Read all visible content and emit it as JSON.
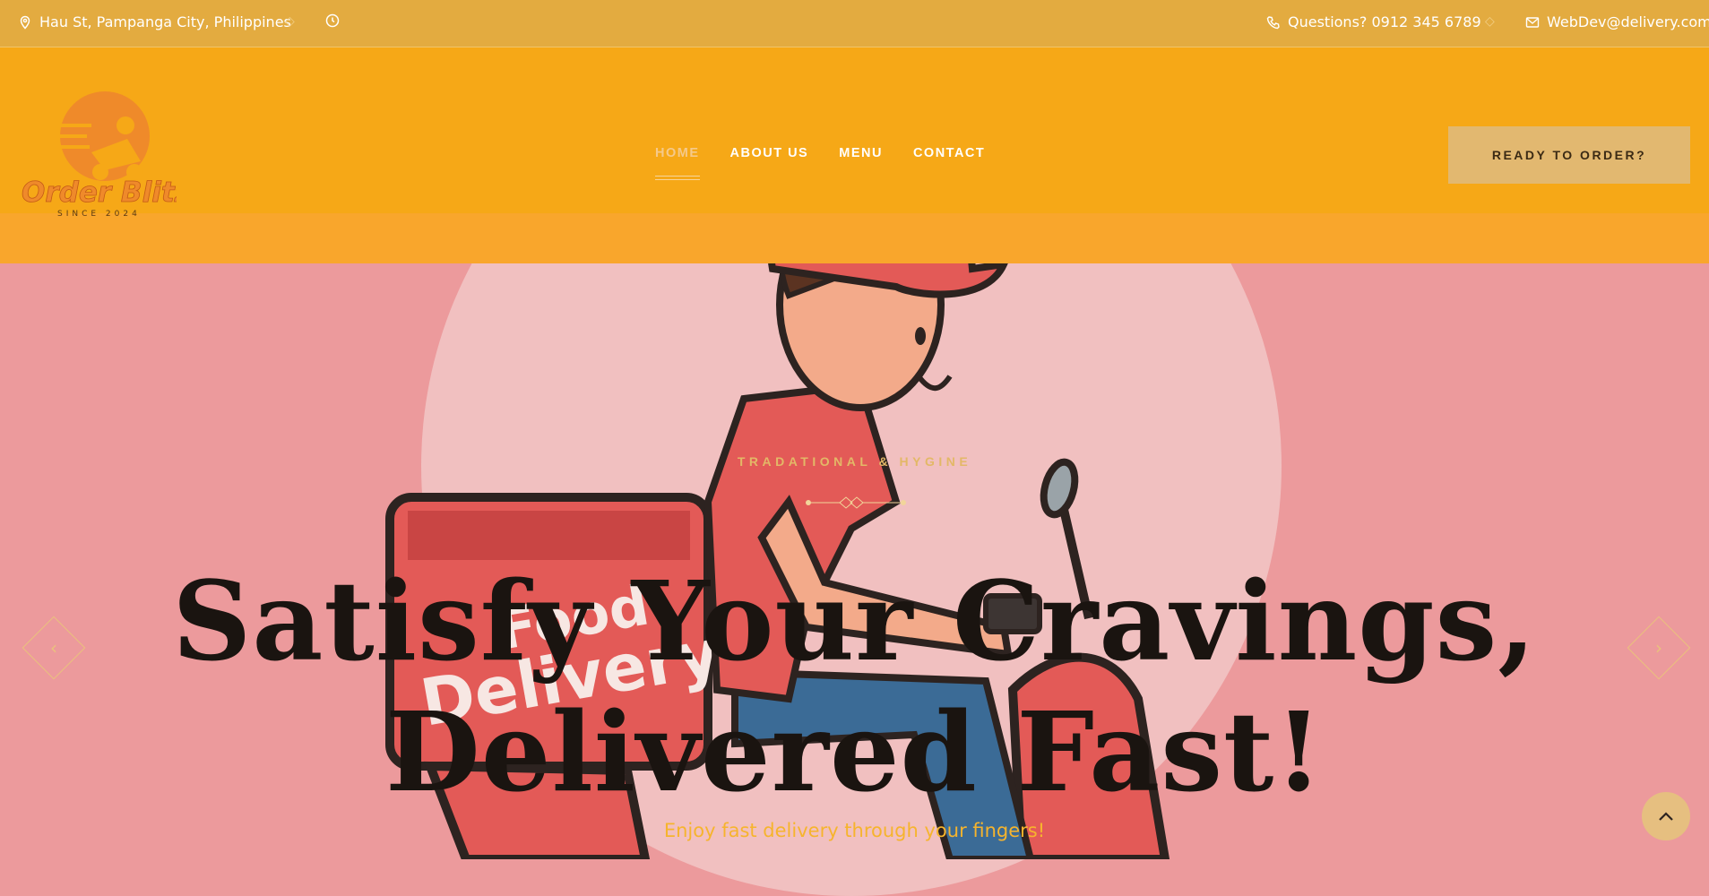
{
  "topbar": {
    "address": "Hau St, Pampanga City, Philippines",
    "phone": "Questions? 0912 345 6789",
    "email": "WebDev@delivery.com"
  },
  "logo": {
    "name": "Order Blitz",
    "tagline": "SINCE 2024"
  },
  "nav": {
    "items": [
      {
        "label": "HOME",
        "active": true
      },
      {
        "label": "ABOUT US"
      },
      {
        "label": "MENU"
      },
      {
        "label": "CONTACT"
      }
    ]
  },
  "header": {
    "cta_label": "READY TO ORDER?"
  },
  "hero": {
    "eyebrow": "TRADATIONAL & HYGINE",
    "title_line1": "Satisfy Your Cravings,",
    "title_line2": "Delivered Fast!",
    "subtitle": "Enjoy fast delivery through your fingers!",
    "illustration_box_text_1": "Food",
    "illustration_box_text_2": "Delivery"
  },
  "icons": {
    "location": "map-pin-icon",
    "clock": "clock-icon",
    "phone": "phone-icon",
    "mail": "mail-icon",
    "prev": "chevron-left-icon",
    "next": "chevron-right-icon",
    "scroll_top": "chevron-up-icon"
  },
  "colors": {
    "topbar": "#e3ab40",
    "header": "#f6a817",
    "hero_bg": "#ec9a9c",
    "accent": "#e2b870"
  }
}
